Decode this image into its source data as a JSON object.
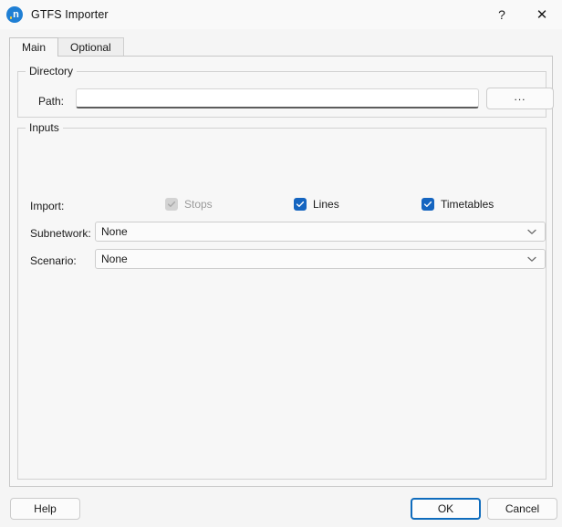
{
  "window": {
    "title": "GTFS Importer",
    "icon": "app-logo-icon",
    "icon_letter": "n",
    "help_glyph": "?",
    "close_glyph": "✕"
  },
  "tabs": [
    {
      "label": "Main",
      "active": true
    },
    {
      "label": "Optional",
      "active": false
    }
  ],
  "directory": {
    "group_title": "Directory",
    "path": {
      "label": "Path:",
      "value": "",
      "placeholder": ""
    },
    "browse_label": "..."
  },
  "inputs": {
    "group_title": "Inputs",
    "import": {
      "label": "Import:",
      "checkboxes": [
        {
          "label": "Stops",
          "checked": true,
          "disabled": true
        },
        {
          "label": "Lines",
          "checked": true,
          "disabled": false
        },
        {
          "label": "Timetables",
          "checked": true,
          "disabled": false
        }
      ]
    },
    "subnetwork": {
      "label": "Subnetwork:",
      "value": "None"
    },
    "scenario": {
      "label": "Scenario:",
      "value": "None"
    }
  },
  "footer": {
    "help_label": "Help",
    "ok_label": "OK",
    "cancel_label": "Cancel"
  },
  "colors": {
    "accent": "#1565c0",
    "default_button_border": "#0f6cbd",
    "disabled_text": "#9a9a9a",
    "panel_background": "#f7f7f7",
    "titlebar_background": "#f9f9f9"
  }
}
